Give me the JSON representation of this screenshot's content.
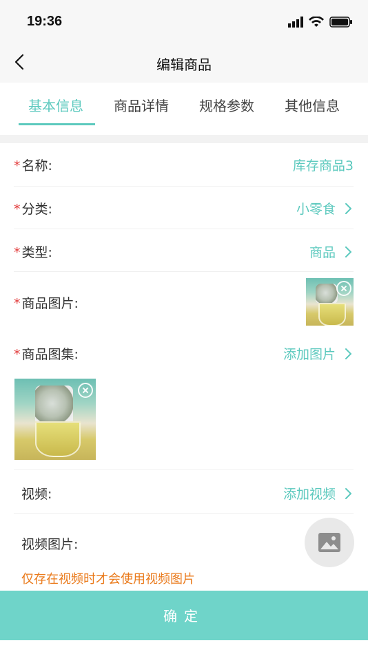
{
  "status": {
    "time": "19:36"
  },
  "nav": {
    "title": "编辑商品"
  },
  "tabs": [
    {
      "label": "基本信息",
      "active": true
    },
    {
      "label": "商品详情",
      "active": false
    },
    {
      "label": "规格参数",
      "active": false
    },
    {
      "label": "其他信息",
      "active": false
    }
  ],
  "form": {
    "required_mark": "*",
    "name": {
      "label": "名称:",
      "value": "库存商品3"
    },
    "category": {
      "label": "分类:",
      "value": "小零食"
    },
    "type": {
      "label": "类型:",
      "value": "商品"
    },
    "image": {
      "label": "商品图片:"
    },
    "gallery": {
      "label": "商品图集:",
      "value": "添加图片"
    },
    "video": {
      "label": "视频:",
      "value": "添加视频"
    },
    "video_image": {
      "label": "视频图片:"
    },
    "video_image_hint": "仅存在视频时才会使用视频图片"
  },
  "confirm_label": "确定",
  "colors": {
    "accent": "#5cc9be",
    "required": "#e23b3b",
    "hint": "#ea7a1b",
    "button": "#6fd4c9"
  },
  "icons": [
    "back-icon",
    "chevron-right-icon",
    "close-circle-icon",
    "image-placeholder-icon",
    "signal-icon",
    "wifi-icon",
    "battery-icon"
  ]
}
